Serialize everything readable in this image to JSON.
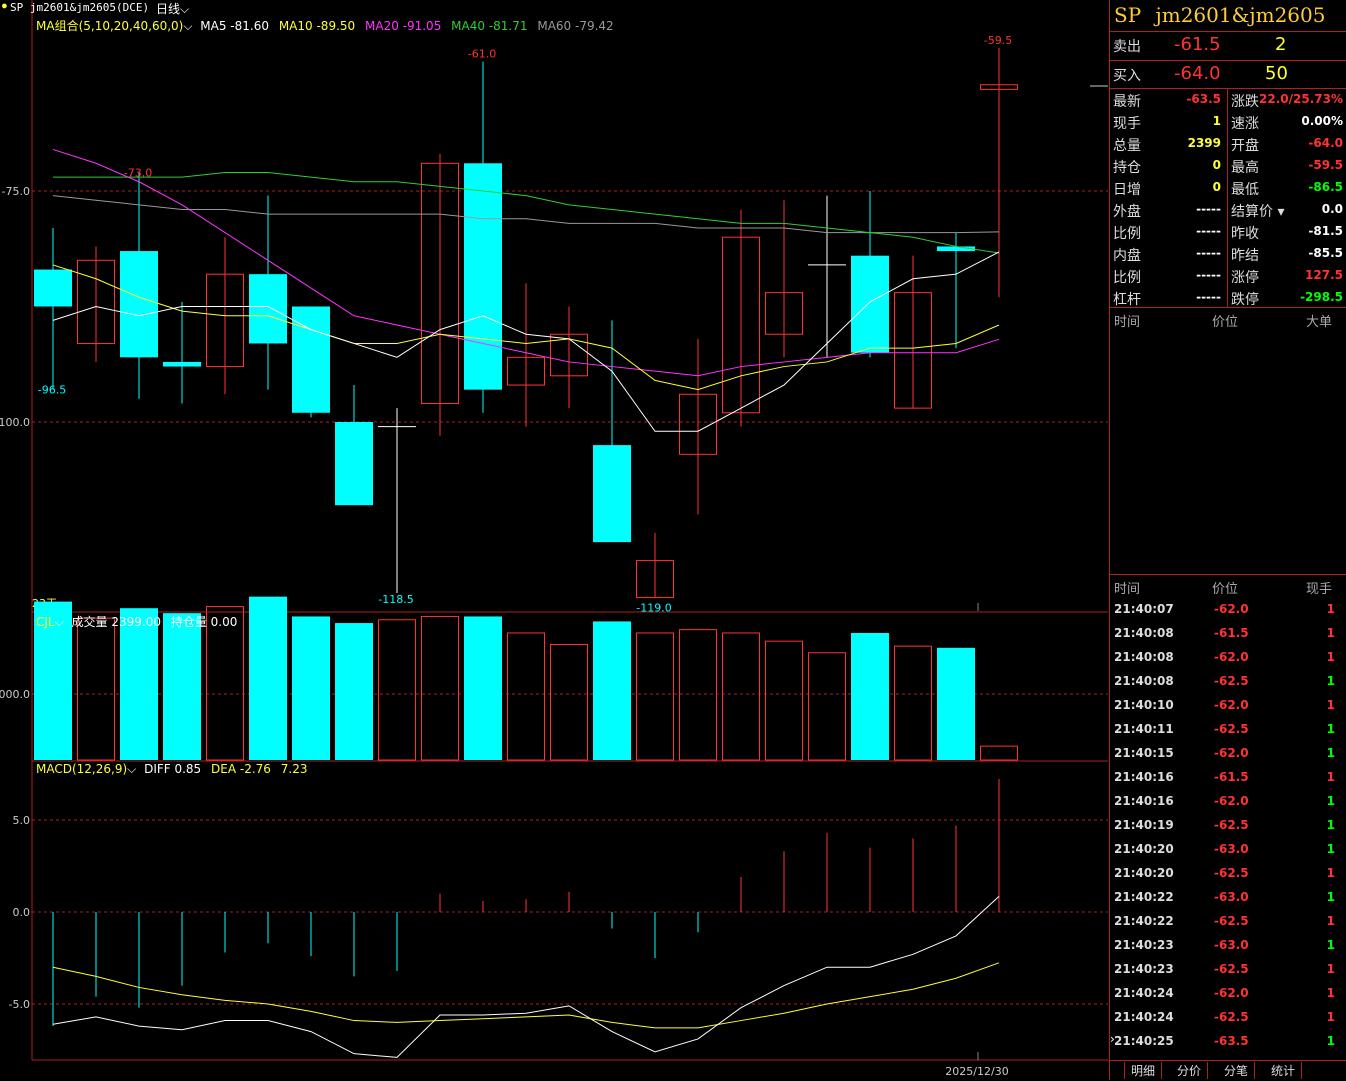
{
  "header": {
    "dot": "●",
    "symbol_label": "SP jm2601&jm2605(DCE)",
    "period": "日线"
  },
  "indicators": {
    "ma": {
      "label": "MA组合(5,10,20,40,60,0)",
      "ma5": "MA5 -81.60",
      "ma10": "MA10 -89.50",
      "ma20": "MA20 -91.05",
      "ma40": "MA40 -81.71",
      "ma60": "MA60 -79.42"
    },
    "vol": {
      "label": "CJL",
      "volume": "成交量 2399.00",
      "oi": "持仓量 0.00"
    },
    "macd": {
      "label": "MACD(12,26,9)",
      "diff": "DIFF 0.85",
      "dea": "DEA -2.76",
      "macd": "7.23"
    }
  },
  "chart_data": {
    "type": "candlestick",
    "price_axis_ticks": [
      "-75.0",
      "100.0"
    ],
    "price_annotations": {
      "high_left": "-73.0",
      "high_mid": "-61.0",
      "high_right": "-59.5",
      "low_left": "-96.5",
      "low_mid1": "-118.5",
      "low_mid2": "-119.0"
    },
    "ohlc": [
      {
        "o": -87.5,
        "h": -79,
        "l": -96.5,
        "c": -83.5,
        "dir": "down"
      },
      {
        "o": -91.5,
        "h": -81,
        "l": -93.5,
        "c": -82.5,
        "dir": "up"
      },
      {
        "o": -81.5,
        "h": -73.0,
        "l": -97.5,
        "c": -93.0,
        "dir": "down"
      },
      {
        "o": -93.5,
        "h": -87,
        "l": -98,
        "c": -94,
        "dir": "down"
      },
      {
        "o": -94,
        "h": -80,
        "l": -97,
        "c": -84,
        "dir": "up"
      },
      {
        "o": -84,
        "h": -75.5,
        "l": -96.5,
        "c": -91.5,
        "dir": "down"
      },
      {
        "o": -87.5,
        "h": -87.5,
        "l": -99.5,
        "c": -99,
        "dir": "down"
      },
      {
        "o": -100,
        "h": -96,
        "l": -109,
        "c": -109,
        "dir": "down"
      },
      {
        "o": -100.5,
        "h": -98.5,
        "l": -118.5,
        "c": -100.5,
        "dir": "flat"
      },
      {
        "o": -98,
        "h": -71,
        "l": -101.5,
        "c": -72,
        "dir": "up"
      },
      {
        "o": -72,
        "h": -61.0,
        "l": -99,
        "c": -96.5,
        "dir": "down"
      },
      {
        "o": -96,
        "h": -85,
        "l": -100.5,
        "c": -93,
        "dir": "up"
      },
      {
        "o": -95,
        "h": -87.5,
        "l": -98.5,
        "c": -90.5,
        "dir": "up"
      },
      {
        "o": -102.5,
        "h": -89,
        "l": -111,
        "c": -113,
        "dir": "down"
      },
      {
        "o": -119.0,
        "h": -112,
        "l": -119.0,
        "c": -115,
        "dir": "up"
      },
      {
        "o": -103.5,
        "h": -91,
        "l": -110,
        "c": -97,
        "dir": "up"
      },
      {
        "o": -99,
        "h": -77,
        "l": -100.5,
        "c": -80,
        "dir": "up"
      },
      {
        "o": -90.5,
        "h": -76,
        "l": -93,
        "c": -86,
        "dir": "up"
      },
      {
        "o": -83,
        "h": -75.5,
        "l": -93,
        "c": -83,
        "dir": "flat"
      },
      {
        "o": -82,
        "h": -75.0,
        "l": -93,
        "c": -92.5,
        "dir": "down"
      },
      {
        "o": -98.5,
        "h": -82,
        "l": -98.5,
        "c": -86,
        "dir": "up"
      },
      {
        "o": -81,
        "h": -79.5,
        "l": -92,
        "c": -81.5,
        "dir": "down"
      },
      {
        "o": -64.0,
        "h": -59.5,
        "l": -86.5,
        "c": -63.5,
        "dir": "up"
      }
    ],
    "ma5": [
      -89,
      -87.5,
      -88.5,
      -87.5,
      -87.5,
      -87.5,
      -90,
      -91.5,
      -93,
      -90,
      -88.5,
      -90.5,
      -91,
      -94.5,
      -101,
      -101,
      -98.5,
      -96,
      -91.5,
      -87,
      -84.5,
      -84,
      -81.6
    ],
    "ma10": [
      -83,
      -84.5,
      -86.5,
      -88,
      -88.5,
      -88.5,
      -90,
      -91.5,
      -91.5,
      -90.5,
      -91,
      -91.5,
      -91,
      -92,
      -95.5,
      -96.5,
      -95,
      -94,
      -93.5,
      -92,
      -92,
      -91.5,
      -89.5
    ],
    "ma20": [
      -70.5,
      -72,
      -74,
      -76.5,
      -79.5,
      -82.5,
      -85.5,
      -88.5,
      -89.5,
      -90.5,
      -91.5,
      -92.5,
      -93.5,
      -94,
      -94.5,
      -95,
      -94,
      -93.5,
      -93,
      -92.5,
      -92.5,
      -92.5,
      -91.05
    ],
    "ma40": [
      -73.5,
      -73.5,
      -73.5,
      -73.5,
      -73,
      -73,
      -73.5,
      -74,
      -74,
      -74.5,
      -75,
      -75.5,
      -76.5,
      -77,
      -77.5,
      -78,
      -78.5,
      -78.5,
      -79,
      -79.5,
      -80,
      -81,
      -81.71
    ],
    "ma60": [
      -75.5,
      -76,
      -76.5,
      -77,
      -77,
      -77.5,
      -77.5,
      -77.5,
      -77.5,
      -77.5,
      -78,
      -78,
      -78.5,
      -78.5,
      -78.5,
      -79,
      -79,
      -79,
      -79.5,
      -79.5,
      -79.5,
      -79.5,
      -79.42
    ],
    "volume_ticks": [
      "000.0"
    ],
    "volume": [
      4800,
      4300,
      4600,
      4450,
      4650,
      4950,
      4350,
      4150,
      4250,
      4350,
      4350,
      3850,
      3500,
      4200,
      3850,
      3950,
      3850,
      3600,
      3250,
      3850,
      3450,
      3400,
      420
    ],
    "vol_dir": [
      "down",
      "up",
      "down",
      "down",
      "up",
      "down",
      "down",
      "down",
      "up",
      "up",
      "down",
      "up",
      "up",
      "down",
      "up",
      "up",
      "up",
      "up",
      "up",
      "down",
      "up",
      "down",
      "up"
    ],
    "macd_ticks": [
      "5.0",
      "0.0",
      "-5.0"
    ],
    "macd_hist": [
      -6.2,
      -4.6,
      -5.2,
      -4,
      -2.2,
      -1.7,
      -2.4,
      -3.5,
      -3.2,
      1.0,
      0.6,
      0.7,
      1.1,
      -0.9,
      -2.5,
      -1.1,
      1.9,
      3.3,
      4.3,
      3.5,
      4.0,
      4.7,
      7.23
    ],
    "diff": [
      -6.1,
      -5.7,
      -6.2,
      -6.4,
      -5.9,
      -5.9,
      -6.5,
      -7.7,
      -7.9,
      -5.6,
      -5.6,
      -5.5,
      -5.1,
      -6.5,
      -7.6,
      -6.9,
      -5.2,
      -4.0,
      -3.0,
      -3.0,
      -2.3,
      -1.3,
      0.85
    ],
    "dea": [
      -3.0,
      -3.5,
      -4.1,
      -4.5,
      -4.8,
      -5.0,
      -5.4,
      -5.9,
      -6.0,
      -5.9,
      -5.8,
      -5.7,
      -5.6,
      -6.0,
      -6.3,
      -6.3,
      -5.9,
      -5.5,
      -5.0,
      -4.6,
      -4.2,
      -3.6,
      -2.76
    ],
    "days_label": "23天",
    "date_label": "2025/12/30"
  },
  "quote": {
    "title_sp": "SP",
    "title_code": "jm2601&jm2605",
    "sell_label": "卖出",
    "sell_price": "-61.5",
    "sell_qty": "2",
    "buy_label": "买入",
    "buy_price": "-64.0",
    "buy_qty": "50",
    "rows": [
      {
        "l1": "最新",
        "v1": "-63.5",
        "c1": "red",
        "l2": "涨跌",
        "v2": "22.0/25.73%",
        "c2": "red"
      },
      {
        "l1": "现手",
        "v1": "1",
        "c1": "yellow",
        "l2": "速涨",
        "v2": "0.00%",
        "c2": "white"
      },
      {
        "l1": "总量",
        "v1": "2399",
        "c1": "yellow",
        "l2": "开盘",
        "v2": "-64.0",
        "c2": "red"
      },
      {
        "l1": "持仓",
        "v1": "0",
        "c1": "yellow",
        "l2": "最高",
        "v2": "-59.5",
        "c2": "red"
      },
      {
        "l1": "日增",
        "v1": "0",
        "c1": "yellow",
        "l2": "最低",
        "v2": "-86.5",
        "c2": "green"
      },
      {
        "l1": "外盘",
        "v1": "-----",
        "c1": "white",
        "l2": "结算价",
        "v2": "0.0",
        "c2": "white"
      },
      {
        "l1": "比例",
        "v1": "-----",
        "c1": "white",
        "l2": "昨收",
        "v2": "-81.5",
        "c2": "white"
      },
      {
        "l1": "内盘",
        "v1": "-----",
        "c1": "white",
        "l2": "昨结",
        "v2": "-85.5",
        "c2": "white"
      },
      {
        "l1": "比例",
        "v1": "-----",
        "c1": "white",
        "l2": "涨停",
        "v2": "127.5",
        "c2": "red"
      },
      {
        "l1": "杠杆",
        "v1": "-----",
        "c1": "white",
        "l2": "跌停",
        "v2": "-298.5",
        "c2": "green"
      }
    ],
    "big_header": {
      "time": "时间",
      "price": "价位",
      "big": "大单"
    },
    "tick_header": {
      "time": "时间",
      "price": "价位",
      "qty": "现手"
    },
    "ticks": [
      {
        "t": "21:40:07",
        "p": "-62.0",
        "q": "1",
        "qc": "red"
      },
      {
        "t": "21:40:08",
        "p": "-61.5",
        "q": "1",
        "qc": "red"
      },
      {
        "t": "21:40:08",
        "p": "-62.0",
        "q": "1",
        "qc": "red"
      },
      {
        "t": "21:40:08",
        "p": "-62.5",
        "q": "1",
        "qc": "green"
      },
      {
        "t": "21:40:10",
        "p": "-62.0",
        "q": "1",
        "qc": "red"
      },
      {
        "t": "21:40:11",
        "p": "-62.5",
        "q": "1",
        "qc": "green"
      },
      {
        "t": "21:40:15",
        "p": "-62.0",
        "q": "1",
        "qc": "green"
      },
      {
        "t": "21:40:16",
        "p": "-61.5",
        "q": "1",
        "qc": "red"
      },
      {
        "t": "21:40:16",
        "p": "-62.0",
        "q": "1",
        "qc": "green"
      },
      {
        "t": "21:40:19",
        "p": "-62.5",
        "q": "1",
        "qc": "green"
      },
      {
        "t": "21:40:20",
        "p": "-63.0",
        "q": "1",
        "qc": "green"
      },
      {
        "t": "21:40:20",
        "p": "-62.5",
        "q": "1",
        "qc": "red"
      },
      {
        "t": "21:40:22",
        "p": "-63.0",
        "q": "1",
        "qc": "green"
      },
      {
        "t": "21:40:22",
        "p": "-62.5",
        "q": "1",
        "qc": "red"
      },
      {
        "t": "21:40:23",
        "p": "-63.0",
        "q": "1",
        "qc": "green"
      },
      {
        "t": "21:40:23",
        "p": "-62.5",
        "q": "1",
        "qc": "red"
      },
      {
        "t": "21:40:24",
        "p": "-62.0",
        "q": "1",
        "qc": "red"
      },
      {
        "t": "21:40:24",
        "p": "-62.5",
        "q": "1",
        "qc": "red"
      },
      {
        "t": "21:40:25",
        "p": "-63.5",
        "q": "1",
        "qc": "green"
      }
    ],
    "tabs": [
      "明细",
      "分价",
      "分笔",
      "统计"
    ]
  },
  "colors": {
    "up": "#ff3333",
    "down": "#00ffff",
    "ma5": "#ffffff",
    "ma10": "#ffff33",
    "ma20": "#ff33ff",
    "ma40": "#33cc33",
    "ma60": "#999999",
    "grid": "#aa2222"
  }
}
